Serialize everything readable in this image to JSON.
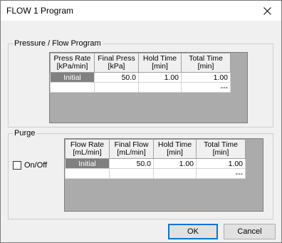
{
  "window": {
    "title": "FLOW 1 Program"
  },
  "pressure_group": {
    "label": "Pressure / Flow Program",
    "columns": [
      "Press Rate\n[kPa/min]",
      "Final Press\n[kPa]",
      "Hold Time\n[min]",
      "Total Time\n[min]"
    ],
    "rows": [
      [
        "Initial",
        "50.0",
        "1.00",
        "1.00"
      ],
      [
        "",
        "",
        "",
        "---"
      ]
    ]
  },
  "purge_group": {
    "label": "Purge",
    "checkbox_label": "On/Off",
    "checkbox_checked": false,
    "columns": [
      "Flow Rate\n[mL/min]",
      "Final Flow\n[mL/min]",
      "Hold Time\n[min]",
      "Total Time\n[min]"
    ],
    "rows": [
      [
        "Initial",
        "50.0",
        "1.00",
        "1.00"
      ],
      [
        "",
        "",
        "",
        "---"
      ]
    ]
  },
  "buttons": {
    "ok": "OK",
    "cancel": "Cancel"
  }
}
